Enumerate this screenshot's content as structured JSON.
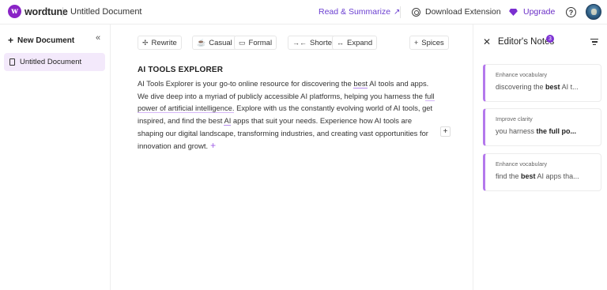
{
  "header": {
    "logo_letter": "w",
    "logo_text": "wordtune",
    "doc_title": "Untitled Document",
    "read_summarize": "Read & Summarize",
    "read_summarize_arrow": "↗",
    "download_extension": "Download Extension",
    "upgrade": "Upgrade",
    "help_glyph": "?",
    "accent_color": "#6b3fd1"
  },
  "sidebar": {
    "new_document": "New Document",
    "collapse_glyph": "«",
    "documents": [
      {
        "label": "Untitled Document",
        "selected": true
      }
    ]
  },
  "toolbar": {
    "rewrite": "Rewrite",
    "casual": "Casual",
    "formal": "Formal",
    "shorten": "Shorten",
    "expand": "Expand",
    "spices": "Spices"
  },
  "editor": {
    "heading": "AI TOOLS EXPLORER",
    "p1": "AI Tools Explorer is your go-to online resource for discovering the ",
    "w_best1": "best",
    "p2": " AI tools and apps. We dive deep into a myriad of publicly accessible AI platforms, helping you harness the ",
    "w_full_power": "full power of artificial intelligence.",
    "p3": " Explore with us the constantly evolving world of AI tools, get inspired, and find the best ",
    "w_ai": "AI",
    "p4": " apps that suit your needs. Experience how AI tools are shaping our digital landscape, transforming industries, and creating vast opportunities for innovation and growt.",
    "inline_plus": "+",
    "side_plus": "+"
  },
  "panel": {
    "close_glyph": "✕",
    "title": "Editor's Notes",
    "badge_count": "3",
    "notes": [
      {
        "label": "Enhance vocabulary",
        "before": "discovering the ",
        "key": "best",
        "after": " AI t..."
      },
      {
        "label": "Improve clarity",
        "before": "you harness ",
        "key": "the full po...",
        "after": ""
      },
      {
        "label": "Enhance vocabulary",
        "before": "find the ",
        "key": "best",
        "after": " AI apps tha..."
      }
    ]
  }
}
